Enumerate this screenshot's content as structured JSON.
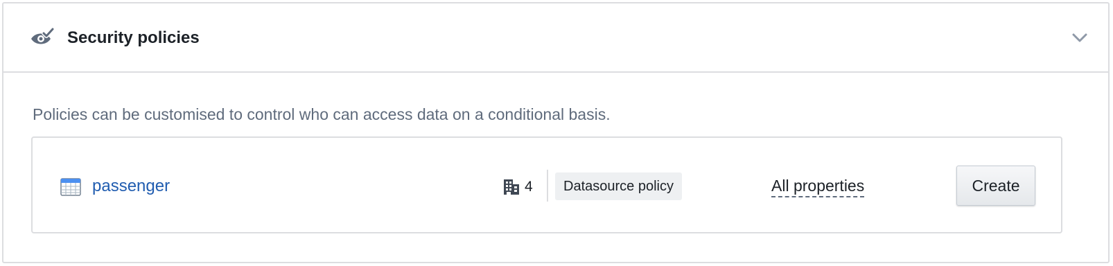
{
  "section": {
    "title": "Security policies",
    "icon": "eye-check-icon",
    "toggle_icon": "chevron-down-icon"
  },
  "description": "Policies can be customised to control who can access data on a conditional basis.",
  "policy": {
    "source_icon": "table-icon",
    "source_name": "passenger",
    "org_icon": "building-icon",
    "org_count": "4",
    "policy_type": "Datasource policy",
    "properties_label": "All properties",
    "create_label": "Create"
  },
  "colors": {
    "link": "#215db0",
    "text": "#1c2127",
    "muted_text": "#5f6b7c",
    "border": "#dcdde0",
    "tag_background": "#eef0f2"
  }
}
